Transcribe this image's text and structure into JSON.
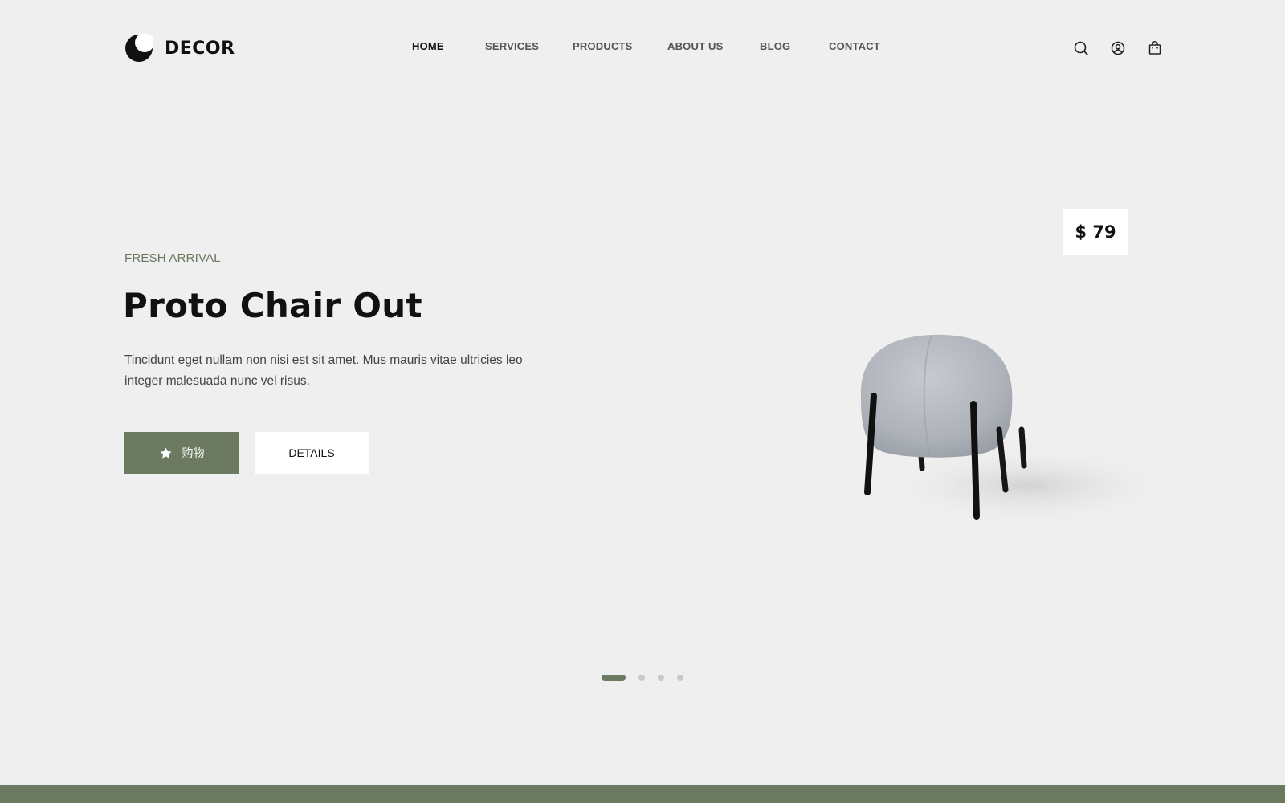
{
  "brand": {
    "name": "DECOR",
    "logo_icon": "half-moon-logo-icon"
  },
  "nav": {
    "items": [
      {
        "label": "HOME",
        "active": true
      },
      {
        "label": "SERVICES",
        "active": false
      },
      {
        "label": "PRODUCTS",
        "active": false
      },
      {
        "label": "ABOUT US",
        "active": false
      },
      {
        "label": "BLOG",
        "active": false
      },
      {
        "label": "CONTACT",
        "active": false
      }
    ]
  },
  "header_icons": [
    "search-icon",
    "user-icon",
    "shopping-bag-icon"
  ],
  "hero": {
    "eyebrow": "FRESH ARRIVAL",
    "title": "Proto Chair Out",
    "description": "Tincidunt eget nullam non nisi est sit amet. Mus mauris vitae ultricies leo integer malesuada nunc vel risus.",
    "primary_button": {
      "label": "购物",
      "icon": "star-icon"
    },
    "secondary_button": {
      "label": "DETAILS"
    },
    "price": "$ 79",
    "product_image": "chair-image"
  },
  "slider": {
    "total": 4,
    "active_index": 0
  },
  "colors": {
    "accent": "#6b7a60",
    "background": "#efefef",
    "text": "#111111"
  }
}
